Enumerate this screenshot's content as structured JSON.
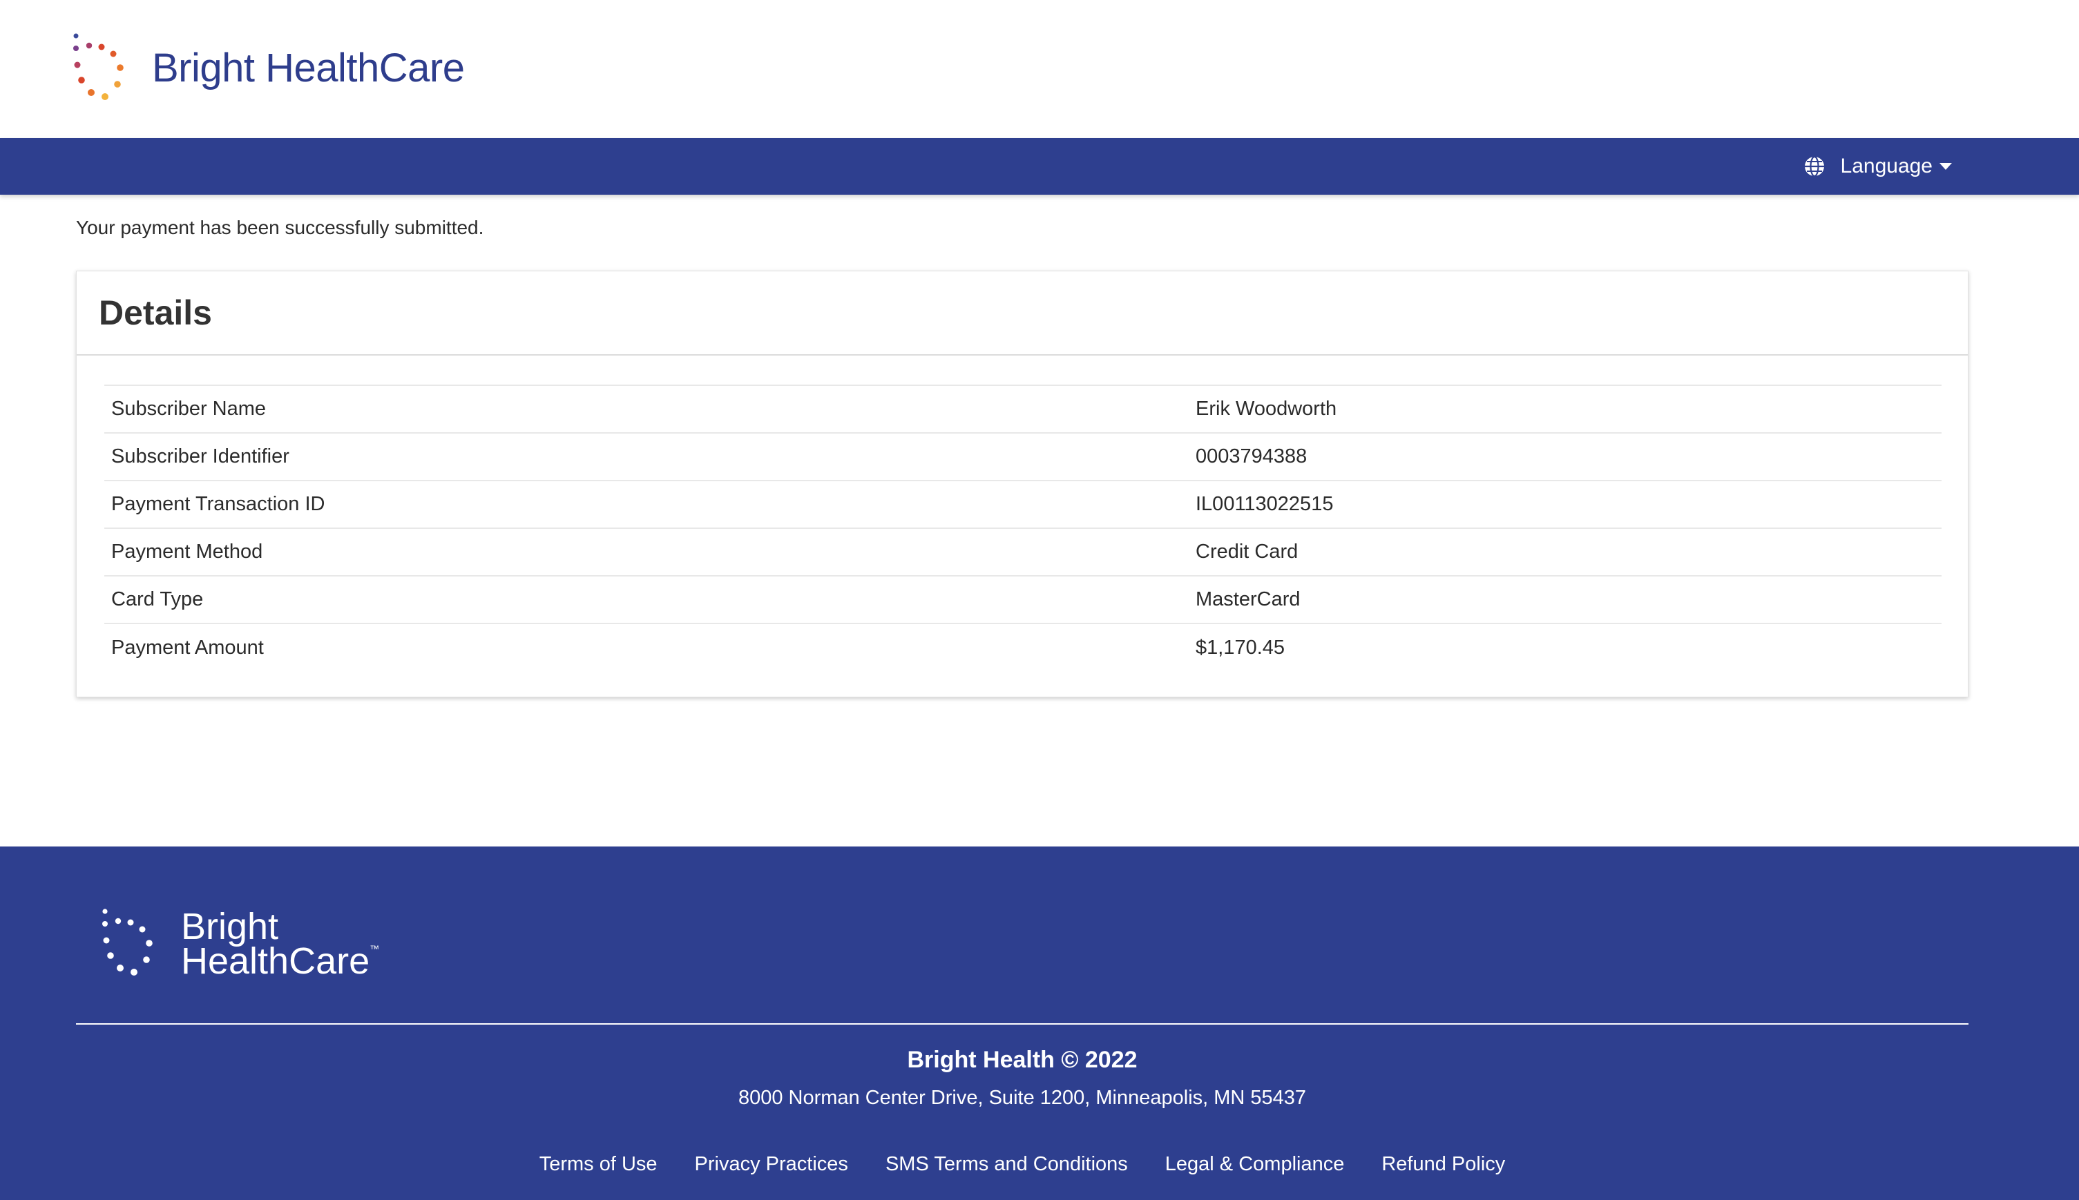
{
  "header": {
    "brand_name": "Bright HealthCare",
    "brand_colors": [
      "#2e3d8c",
      "#d9452b",
      "#f0a23a",
      "#8a3a7a"
    ]
  },
  "navbar": {
    "language_label": "Language",
    "language_icon": "globe-icon",
    "background": "#2e3f8f"
  },
  "main": {
    "status_message": "Your payment has been successfully submitted.",
    "card_title": "Details",
    "rows": [
      {
        "label": "Subscriber Name",
        "value": "Erik Woodworth"
      },
      {
        "label": "Subscriber Identifier",
        "value": "0003794388"
      },
      {
        "label": "Payment Transaction ID",
        "value": "IL00113022515"
      },
      {
        "label": "Payment Method",
        "value": "Credit Card"
      },
      {
        "label": "Card Type",
        "value": "MasterCard"
      },
      {
        "label": "Payment Amount",
        "value": "$1,170.45"
      }
    ]
  },
  "footer": {
    "brand_line1": "Bright",
    "brand_line2": "HealthCare",
    "trademark": "™",
    "copyright": "Bright Health © 2022",
    "address": "8000 Norman Center Drive, Suite 1200, Minneapolis, MN 55437",
    "links": [
      "Terms of Use",
      "Privacy Practices",
      "SMS Terms and Conditions",
      "Legal & Compliance",
      "Refund Policy"
    ]
  }
}
